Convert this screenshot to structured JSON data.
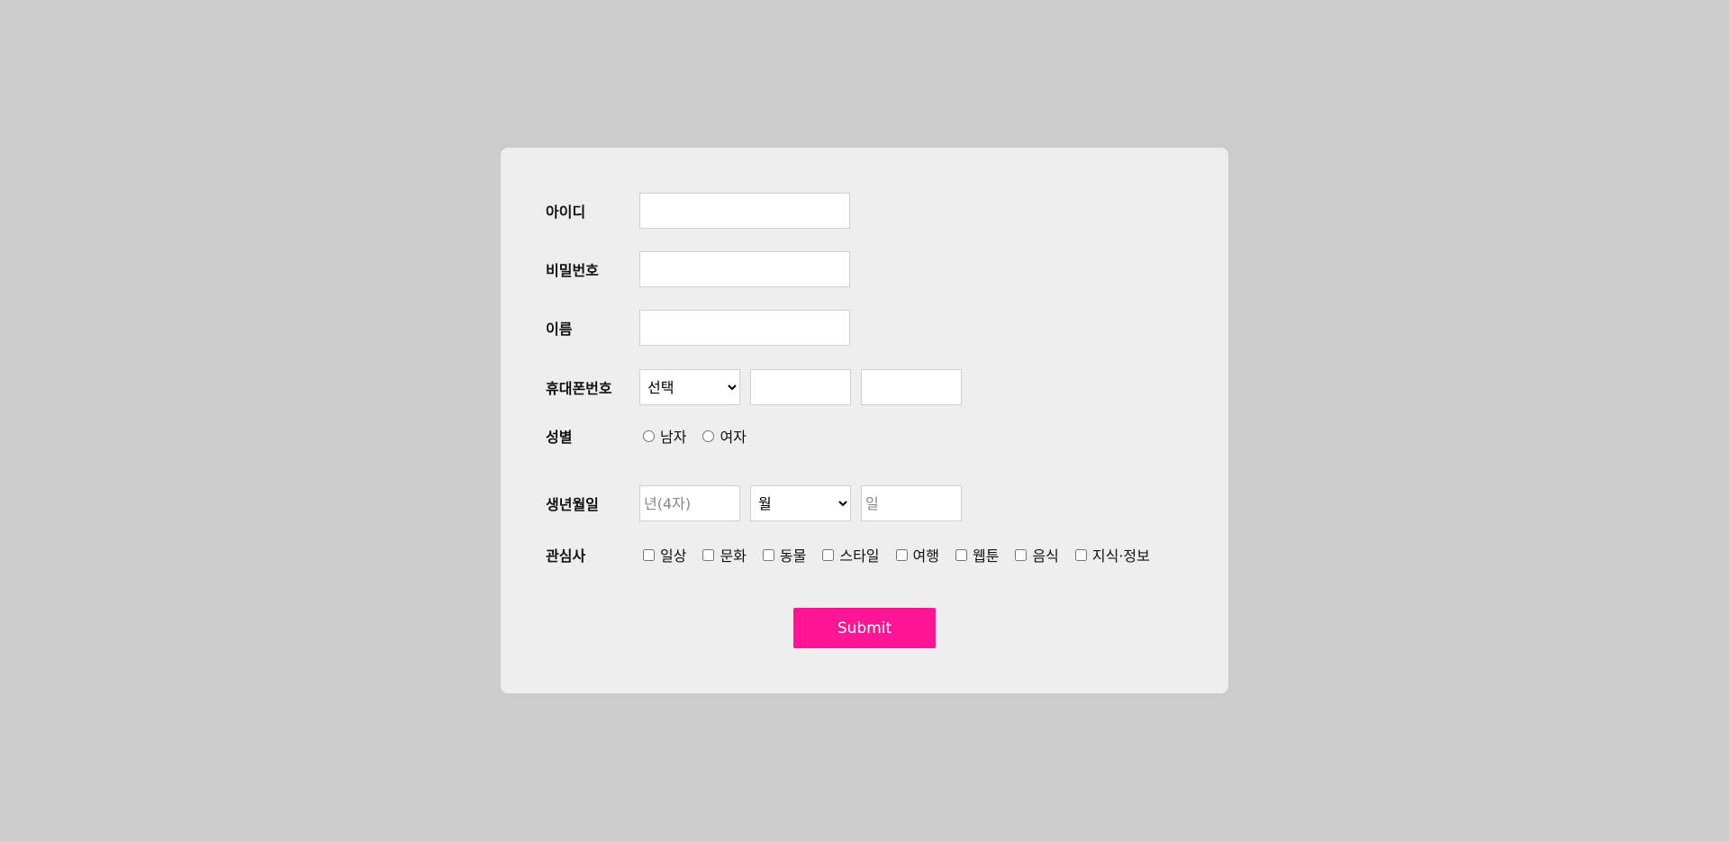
{
  "form": {
    "id": {
      "label": "아이디",
      "value": ""
    },
    "password": {
      "label": "비밀번호",
      "value": ""
    },
    "name": {
      "label": "이름",
      "value": ""
    },
    "phone": {
      "label": "휴대폰번호",
      "prefix_selected": "선택",
      "middle": "",
      "last": ""
    },
    "gender": {
      "label": "성별",
      "options": [
        "남자",
        "여자"
      ]
    },
    "birth": {
      "label": "생년월일",
      "year_placeholder": "년(4자)",
      "month_selected": "월",
      "day_placeholder": "일"
    },
    "interests": {
      "label": "관심사",
      "options": [
        "일상",
        "문화",
        "동물",
        "스타일",
        "여행",
        "웹툰",
        "음식",
        "지식·정보"
      ]
    },
    "submit_label": "Submit"
  },
  "colors": {
    "page_background": "#cccccc",
    "card_background": "#eeeeee",
    "submit_background": "#ff1493",
    "submit_text": "#ffffff"
  }
}
